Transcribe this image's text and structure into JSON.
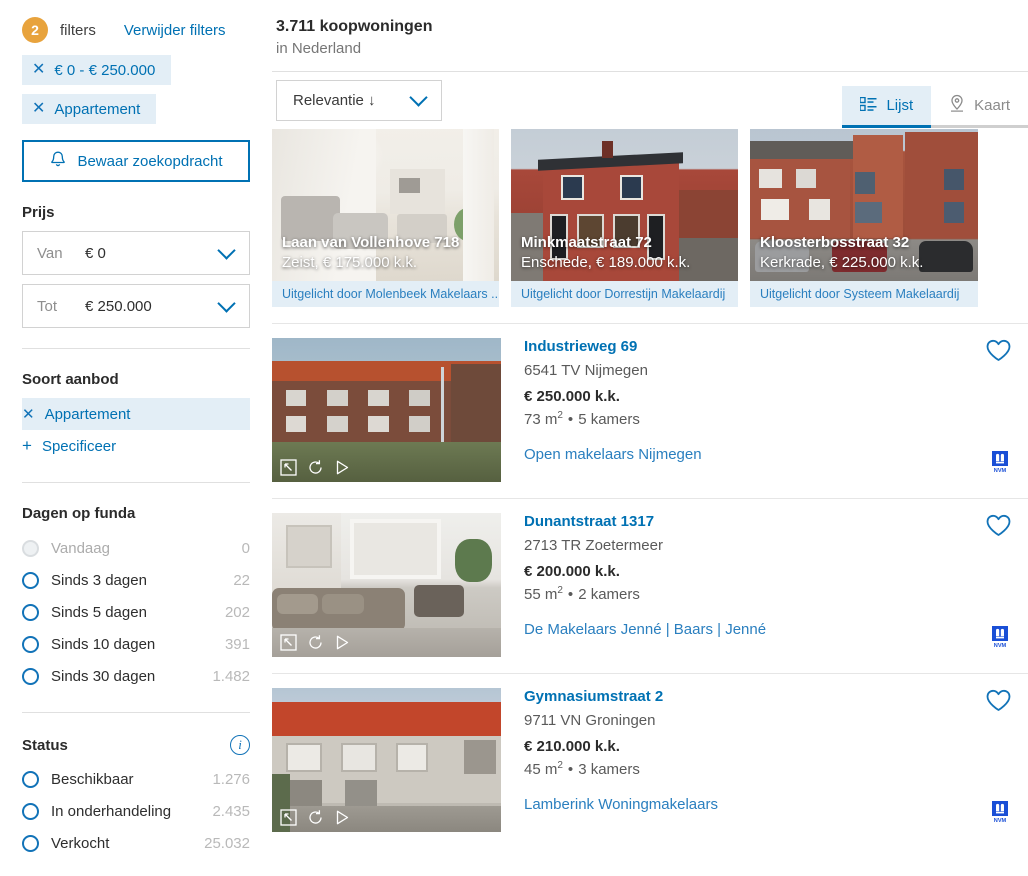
{
  "sidebar": {
    "filters": {
      "count": "2",
      "label": "filters",
      "clear_label": "Verwijder filters",
      "pills": [
        {
          "name": "price-range",
          "label": "€ 0 - € 250.000"
        },
        {
          "name": "property-type",
          "label": "Appartement"
        }
      ],
      "save_search_label": "Bewaar zoekopdracht",
      "bell_icon": "bell-icon"
    },
    "price": {
      "title": "Prijs",
      "from": {
        "label": "Van",
        "value": "€ 0"
      },
      "to": {
        "label": "Tot",
        "value": "€ 250.000"
      }
    },
    "offer_type": {
      "title": "Soort aanbod",
      "selected": "Appartement",
      "specify": "Specificeer"
    },
    "days_on_funda": {
      "title": "Dagen op funda",
      "options": [
        {
          "label": "Vandaag",
          "count": "0",
          "disabled": true
        },
        {
          "label": "Sinds 3 dagen",
          "count": "22",
          "disabled": false
        },
        {
          "label": "Sinds 5 dagen",
          "count": "202",
          "disabled": false
        },
        {
          "label": "Sinds 10 dagen",
          "count": "391",
          "disabled": false
        },
        {
          "label": "Sinds 30 dagen",
          "count": "1.482",
          "disabled": false
        }
      ]
    },
    "status": {
      "title": "Status",
      "info_icon": "info-icon",
      "options": [
        {
          "label": "Beschikbaar",
          "count": "1.276"
        },
        {
          "label": "In onderhandeling",
          "count": "2.435"
        },
        {
          "label": "Verkocht",
          "count": "25.032"
        }
      ]
    }
  },
  "main": {
    "result_count": "3.711 koopwoningen",
    "result_location": "in Nederland",
    "sort": {
      "value": "Relevantie ↓"
    },
    "view_tabs": [
      {
        "label": "Lijst",
        "icon": "list-icon",
        "active": true
      },
      {
        "label": "Kaart",
        "icon": "map-pin-icon",
        "active": false
      }
    ],
    "featured": [
      {
        "title": "Laan van Vollenhove 718",
        "subtitle": "Zeist, € 175.000 k.k.",
        "sponsor": "Uitgelicht door Molenbeek Makelaars ..."
      },
      {
        "title": "Minkmaatstraat 72",
        "subtitle": "Enschede, € 189.000 k.k.",
        "sponsor": "Uitgelicht door Dorrestijn Makelaardij"
      },
      {
        "title": "Kloosterbosstraat 32",
        "subtitle": "Kerkrade, € 225.000 k.k.",
        "sponsor": "Uitgelicht door Systeem Makelaardij"
      }
    ],
    "listings": [
      {
        "title": "Industrieweg 69",
        "address": "6541 TV Nijmegen",
        "price": "€ 250.000 k.k.",
        "area": "73 m²",
        "rooms": "5 kamers",
        "agent": "Open makelaars Nijmegen",
        "badge": "NVM",
        "favorite_icon": "heart-icon"
      },
      {
        "title": "Dunantstraat 1317",
        "address": "2713 TR Zoetermeer",
        "price": "€ 200.000 k.k.",
        "area": "55 m²",
        "rooms": "2 kamers",
        "agent": "De Makelaars Jenné | Baars | Jenné",
        "badge": "NVM",
        "favorite_icon": "heart-icon"
      },
      {
        "title": "Gymnasiumstraat 2",
        "address": "9711 VN Groningen",
        "price": "€ 210.000 k.k.",
        "area": "45 m²",
        "rooms": "3 kamers",
        "agent": "Lamberink Woningmakelaars",
        "badge": "NVM",
        "favorite_icon": "heart-icon"
      }
    ],
    "photo_icons": [
      "floorplan-icon",
      "rotate-360-icon",
      "play-video-icon"
    ]
  },
  "colors": {
    "accent_blue": "#0071b3",
    "link_blue": "#2a7fbf",
    "pill_bg": "#e3eef6",
    "badge_orange": "#e8a33d",
    "nvm_blue": "#1a4fd6"
  }
}
